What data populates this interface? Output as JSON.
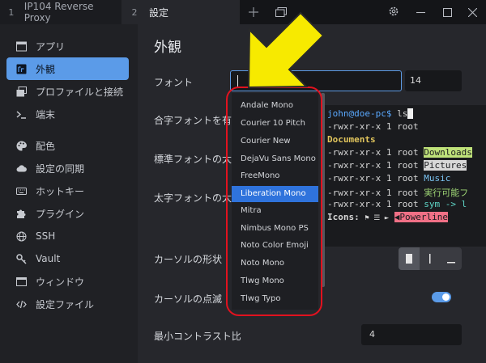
{
  "tabs": [
    {
      "index": "1",
      "label": "IP104 Reverse Proxy"
    },
    {
      "index": "2",
      "label": "設定"
    }
  ],
  "window_controls": [
    "add-tab-icon",
    "tab-list-icon",
    "settings-icon",
    "minimize-icon",
    "maximize-icon",
    "close-icon"
  ],
  "sidebar": {
    "items": [
      {
        "label": "アプリ",
        "icon": "app-window-icon"
      },
      {
        "label": "外観",
        "icon": "appearance-icon",
        "active": true
      },
      {
        "label": "プロファイルと接続",
        "icon": "profiles-icon"
      },
      {
        "label": "端末",
        "icon": "terminal-icon"
      },
      {
        "label": "配色",
        "icon": "palette-icon"
      },
      {
        "label": "設定の同期",
        "icon": "cloud-icon"
      },
      {
        "label": "ホットキー",
        "icon": "keyboard-icon"
      },
      {
        "label": "プラグイン",
        "icon": "puzzle-icon"
      },
      {
        "label": "SSH",
        "icon": "globe-icon"
      },
      {
        "label": "Vault",
        "icon": "key-icon"
      },
      {
        "label": "ウィンドウ",
        "icon": "window-icon"
      },
      {
        "label": "設定ファイル",
        "icon": "code-icon"
      }
    ]
  },
  "main": {
    "title": "外観",
    "font_label": "フォント",
    "font_value": "",
    "font_size": "14",
    "ligatures_label": "合字フォントを有効",
    "normal_weight_label": "標準フォントの太さ",
    "bold_weight_label": "太字フォントの太さ",
    "cursor_shape_label": "カーソルの形状",
    "cursor_blink_label": "カーソルの点滅",
    "cursor_blink_on": true,
    "min_contrast_label": "最小コントラスト比",
    "min_contrast_value": "4"
  },
  "preview": {
    "prompt_user": "john@doe-pc$",
    "command": " ls",
    "lines": [
      {
        "perm": "-rwxr-xr-x 1 root ",
        "name": "Documents"
      },
      {
        "perm": "-rwxr-xr-x 1 root ",
        "name": "Downloads"
      },
      {
        "perm": "-rwxr-xr-x 1 root ",
        "name": "Pictures"
      },
      {
        "perm": "-rwxr-xr-x 1 root ",
        "name": "Music"
      },
      {
        "perm": "-rwxr-xr-x 1 root ",
        "name": "実行可能フ"
      },
      {
        "perm": "-rwxr-xr-x 1 root ",
        "name": "sym -> l"
      }
    ],
    "icons_label": "Icons:",
    "powerline_label": "Powerline"
  },
  "font_dropdown": {
    "options": [
      "Andale Mono",
      "Courier 10 Pitch",
      "Courier New",
      "DejaVu Sans Mono",
      "FreeMono",
      "Liberation Mono",
      "Mitra",
      "Nimbus Mono PS",
      "Noto Color Emoji",
      "Noto Mono",
      "Tlwg Mono",
      "Tlwg Typo"
    ],
    "selected": "Liberation Mono"
  },
  "colors": {
    "accent": "#5b9be8",
    "selection": "#2f73dc",
    "annotation_red": "#e1121f",
    "annotation_arrow": "#f7ea00"
  }
}
